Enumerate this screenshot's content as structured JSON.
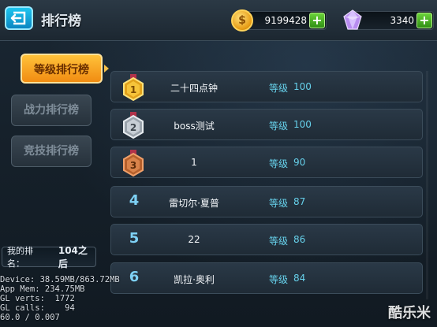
{
  "header": {
    "title": "排行榜",
    "gold": "9199428",
    "gems": "3340"
  },
  "tabs": [
    {
      "label": "等级排行榜",
      "active": true
    },
    {
      "label": "战力排行榜",
      "active": false
    },
    {
      "label": "竞技排行榜",
      "active": false
    }
  ],
  "my_rank": {
    "label": "我的排名：",
    "value": "104之后"
  },
  "rows": [
    {
      "rank": "1",
      "medal": "gold-medal-icon",
      "name": "二十四点钟",
      "level_label": "等级",
      "level": "100"
    },
    {
      "rank": "2",
      "medal": "silver-medal-icon",
      "name": "boss测试",
      "level_label": "等级",
      "level": "100"
    },
    {
      "rank": "3",
      "medal": "bronze-medal-icon",
      "name": "1",
      "level_label": "等级",
      "level": "90"
    },
    {
      "rank": "4",
      "name": "雷切尔·夏普",
      "level_label": "等级",
      "level": "87"
    },
    {
      "rank": "5",
      "name": "22",
      "level_label": "等级",
      "level": "86"
    },
    {
      "rank": "6",
      "name": "凯拉·奥利",
      "level_label": "等级",
      "level": "84"
    }
  ],
  "debug": {
    "line1": "Device: 38.59MB/863.72MB",
    "line2": "App Mem: 234.75MB",
    "line3": "GL verts:  1772",
    "line4": "GL calls:    94",
    "line5": "60.0 / 0.007"
  },
  "watermark": "酷乐米",
  "colors": {
    "accent_gold": "#f18c12",
    "level_text": "#66d0ea",
    "rank_number": "#7ed1f5",
    "plus_green": "#2f8e14"
  }
}
